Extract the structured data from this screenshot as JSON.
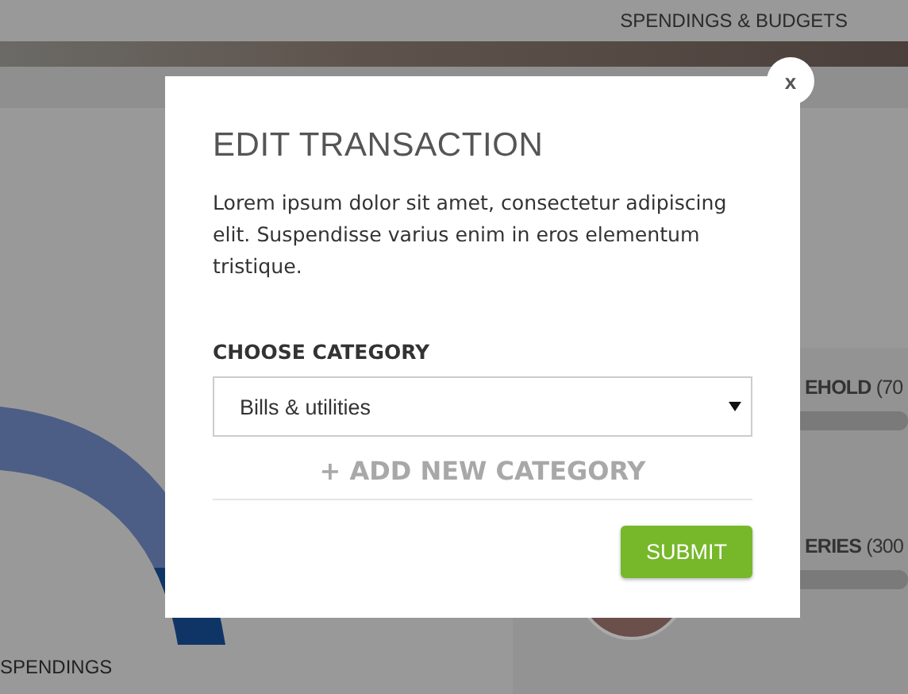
{
  "nav": {
    "label": "SPENDINGS & BUDGETS"
  },
  "background": {
    "chart_label": "SPENDINGS",
    "budgets": [
      {
        "label": "**EHOLD** (70",
        "level": 1
      },
      {
        "label": "**ERIES** (300",
        "level": 1
      }
    ]
  },
  "modal": {
    "close": "x",
    "title": "EDIT TRANSACTION",
    "text": "Lorem ipsum dolor sit amet, consectetur adipiscing elit. Suspendisse varius enim in eros elementum tristique.",
    "field_label": "CHOOSE CATEGORY",
    "select_value": "Bills & utilities",
    "add_link": "+ ADD NEW CATEGORY",
    "submit": "SUBMIT"
  }
}
